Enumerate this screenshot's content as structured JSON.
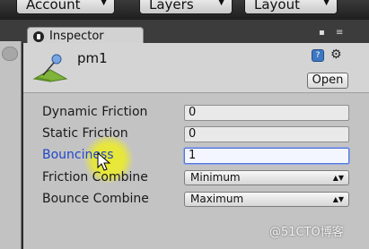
{
  "toolbar": {
    "account": "Account",
    "layers": "Layers",
    "layout": "Layout"
  },
  "inspector": {
    "tab_label": "Inspector",
    "asset_name": "pm1",
    "open_label": "Open"
  },
  "properties": [
    {
      "label": "Dynamic Friction",
      "value": "0"
    },
    {
      "label": "Static Friction",
      "value": "0"
    },
    {
      "label": "Bounciness",
      "value": "1"
    },
    {
      "label": "Friction Combine",
      "value": "Minimum"
    },
    {
      "label": "Bounce Combine",
      "value": "Maximum"
    }
  ],
  "watermark": "@51CTO博客",
  "colors": {
    "active_label": "#1f47c9",
    "highlight": "#ecec28"
  }
}
